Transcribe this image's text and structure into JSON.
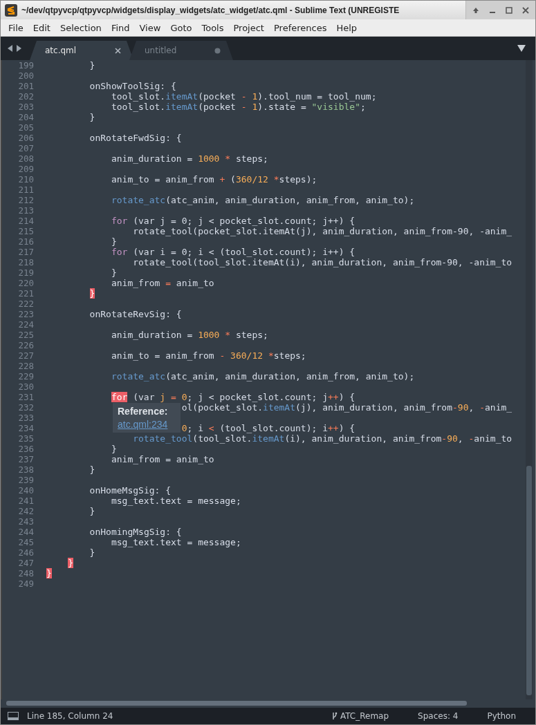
{
  "window": {
    "title": "~/dev/qtpyvcp/qtpyvcp/widgets/display_widgets/atc_widget/atc.qml - Sublime Text (UNREGISTE"
  },
  "menu": [
    "File",
    "Edit",
    "Selection",
    "Find",
    "View",
    "Goto",
    "Tools",
    "Project",
    "Preferences",
    "Help"
  ],
  "tabs": [
    {
      "label": "atc.qml",
      "selected": true,
      "modified": false
    },
    {
      "label": "untitled",
      "selected": false,
      "modified": true
    }
  ],
  "lines": [
    {
      "number": "199",
      "code": [
        {
          "kind": "plain",
          "text": "        }"
        }
      ]
    },
    {
      "number": "200"
    },
    {
      "number": "201",
      "code": [
        {
          "kind": "plain",
          "text": "        onShowToolSig: {"
        }
      ]
    },
    {
      "number": "202",
      "code": [
        {
          "kind": "plain",
          "text": "            tool_slot."
        },
        {
          "kind": "func",
          "text": "itemAt"
        },
        {
          "kind": "plain",
          "text": "(pocket "
        },
        {
          "kind": "op",
          "text": "-"
        },
        {
          "kind": "num",
          "text": " 1"
        },
        {
          "kind": "plain",
          "text": ").tool_num = tool_num;"
        }
      ]
    },
    {
      "number": "203",
      "code": [
        {
          "kind": "plain",
          "text": "            tool_slot."
        },
        {
          "kind": "func",
          "text": "itemAt"
        },
        {
          "kind": "plain",
          "text": "(pocket "
        },
        {
          "kind": "op",
          "text": "-"
        },
        {
          "kind": "num",
          "text": " 1"
        },
        {
          "kind": "plain",
          "text": ").state = "
        },
        {
          "kind": "str",
          "text": "\"visible\""
        },
        {
          "kind": "plain",
          "text": ";"
        }
      ]
    },
    {
      "number": "204",
      "code": [
        {
          "kind": "plain",
          "text": "        }"
        }
      ]
    },
    {
      "number": "205"
    },
    {
      "number": "206",
      "code": [
        {
          "kind": "plain",
          "text": "        onRotateFwdSig: {"
        }
      ]
    },
    {
      "number": "207"
    },
    {
      "number": "208",
      "code": [
        {
          "kind": "plain",
          "text": "            anim_duration = "
        },
        {
          "kind": "num",
          "text": "1000"
        },
        {
          "kind": "op",
          "text": " *"
        },
        {
          "kind": "plain",
          "text": " steps;"
        }
      ]
    },
    {
      "number": "209"
    },
    {
      "number": "210",
      "code": [
        {
          "kind": "plain",
          "text": "            anim_to = anim_from "
        },
        {
          "kind": "op",
          "text": "+"
        },
        {
          "kind": "plain",
          "text": " ("
        },
        {
          "kind": "num",
          "text": "360/12"
        },
        {
          "kind": "op",
          "text": " *"
        },
        {
          "kind": "plain",
          "text": "steps);"
        }
      ]
    },
    {
      "number": "211"
    },
    {
      "number": "212",
      "code": [
        {
          "kind": "func",
          "text": "            rotate_atc"
        },
        {
          "kind": "plain",
          "text": "(atc_anim, anim_duration, anim_from, anim_to);"
        }
      ]
    },
    {
      "number": "213"
    },
    {
      "number": "214",
      "code": [
        {
          "kind": "keyword",
          "text": "            for"
        },
        {
          "kind": "plain",
          "text": " (var j = 0; j < pocket_slot.count; j++) {"
        }
      ]
    },
    {
      "number": "215",
      "code": [
        {
          "kind": "plain",
          "text": "                rotate_tool(pocket_slot.itemAt(j), anim_duration, anim_from-90, -anim_"
        }
      ]
    },
    {
      "number": "216",
      "code": [
        {
          "kind": "plain",
          "text": "            }"
        }
      ]
    },
    {
      "number": "217",
      "code": [
        {
          "kind": "keyword",
          "text": "            for"
        },
        {
          "kind": "plain",
          "text": " (var i = 0; i < (tool_slot.count); i++) {"
        }
      ]
    },
    {
      "number": "218",
      "code": [
        {
          "kind": "plain",
          "text": "                rotate_tool(tool_slot.itemAt(i), anim_duration, anim_from-90, -anim_to"
        }
      ]
    },
    {
      "number": "219",
      "code": [
        {
          "kind": "plain",
          "text": "            }"
        }
      ]
    },
    {
      "number": "220",
      "code": [
        {
          "kind": "plain",
          "text": "            anim_from "
        },
        {
          "kind": "op",
          "text": "="
        },
        {
          "kind": "plain",
          "text": " anim_to"
        }
      ]
    },
    {
      "number": "221",
      "code": [
        {
          "kind": "match",
          "text": "        }"
        }
      ]
    },
    {
      "number": "222"
    },
    {
      "number": "223",
      "code": [
        {
          "kind": "plain",
          "text": "        onRotateRevSig: {"
        }
      ]
    },
    {
      "number": "224"
    },
    {
      "number": "225",
      "code": [
        {
          "kind": "plain",
          "text": "            anim_duration = "
        },
        {
          "kind": "num",
          "text": "1000"
        },
        {
          "kind": "op",
          "text": " *"
        },
        {
          "kind": "plain",
          "text": " steps;"
        }
      ]
    },
    {
      "number": "226"
    },
    {
      "number": "227",
      "code": [
        {
          "kind": "plain",
          "text": "            anim_to = anim_from "
        },
        {
          "kind": "op",
          "text": "-"
        },
        {
          "kind": "num",
          "text": " 360/12"
        },
        {
          "kind": "op",
          "text": " *"
        },
        {
          "kind": "plain",
          "text": "steps;"
        }
      ]
    },
    {
      "number": "228"
    },
    {
      "number": "229",
      "code": [
        {
          "kind": "func",
          "text": "            rotate_atc"
        },
        {
          "kind": "plain",
          "text": "(atc_anim, anim_duration, anim_from, anim_to);"
        }
      ]
    },
    {
      "number": "230"
    },
    {
      "number": "231",
      "code": [
        {
          "kind": "match",
          "text": "            for"
        },
        {
          "kind": "plain",
          "text": " (var "
        },
        {
          "kind": "num",
          "text": "j"
        },
        {
          "kind": "op",
          "text": " ="
        },
        {
          "kind": "num",
          "text": " 0"
        },
        {
          "kind": "plain",
          "text": "; j < pocket_slot.count; j"
        },
        {
          "kind": "op",
          "text": "++"
        },
        {
          "kind": "plain",
          "text": ") {"
        }
      ]
    },
    {
      "number": "232",
      "code": [
        {
          "kind": "plain",
          "text": "                         ol(pocket_slot."
        },
        {
          "kind": "func",
          "text": "itemAt"
        },
        {
          "kind": "plain",
          "text": "(j), anim_duration, anim_from"
        },
        {
          "kind": "op",
          "text": "-"
        },
        {
          "kind": "num",
          "text": "90"
        },
        {
          "kind": "plain",
          "text": ", "
        },
        {
          "kind": "op",
          "text": "-"
        },
        {
          "kind": "plain",
          "text": "anim_"
        }
      ]
    },
    {
      "number": "233"
    },
    {
      "number": "234",
      "code": [
        {
          "kind": "num",
          "text": "                         0"
        },
        {
          "kind": "plain",
          "text": "; i "
        },
        {
          "kind": "op",
          "text": "<"
        },
        {
          "kind": "plain",
          "text": " (tool_slot.count); i"
        },
        {
          "kind": "op",
          "text": "++"
        },
        {
          "kind": "plain",
          "text": ") {"
        }
      ]
    },
    {
      "number": "235",
      "code": [
        {
          "kind": "func",
          "text": "                rotate_tool"
        },
        {
          "kind": "plain",
          "text": "(tool_slot."
        },
        {
          "kind": "func",
          "text": "itemAt"
        },
        {
          "kind": "plain",
          "text": "(i), anim_duration, anim_from"
        },
        {
          "kind": "op",
          "text": "-"
        },
        {
          "kind": "num",
          "text": "90"
        },
        {
          "kind": "plain",
          "text": ", "
        },
        {
          "kind": "op",
          "text": "-"
        },
        {
          "kind": "plain",
          "text": "anim_to"
        }
      ]
    },
    {
      "number": "236",
      "code": [
        {
          "kind": "plain",
          "text": "            }"
        }
      ]
    },
    {
      "number": "237",
      "code": [
        {
          "kind": "plain",
          "text": "            anim_from = anim_to"
        }
      ]
    },
    {
      "number": "238",
      "code": [
        {
          "kind": "plain",
          "text": "        }"
        }
      ]
    },
    {
      "number": "239"
    },
    {
      "number": "240",
      "code": [
        {
          "kind": "plain",
          "text": "        onHomeMsgSig: {"
        }
      ]
    },
    {
      "number": "241",
      "code": [
        {
          "kind": "plain",
          "text": "            msg_text.text = message;"
        }
      ]
    },
    {
      "number": "242",
      "code": [
        {
          "kind": "plain",
          "text": "        }"
        }
      ]
    },
    {
      "number": "243"
    },
    {
      "number": "244",
      "code": [
        {
          "kind": "plain",
          "text": "        onHomingMsgSig: {"
        }
      ]
    },
    {
      "number": "245",
      "code": [
        {
          "kind": "plain",
          "text": "            msg_text.text = message;"
        }
      ]
    },
    {
      "number": "246",
      "code": [
        {
          "kind": "plain",
          "text": "        }"
        }
      ]
    },
    {
      "number": "247",
      "code": [
        {
          "kind": "match",
          "text": "    }"
        }
      ]
    },
    {
      "number": "248",
      "code": [
        {
          "kind": "match",
          "text": "}"
        }
      ]
    },
    {
      "number": "249"
    }
  ],
  "tooltip": {
    "title": "Reference:",
    "link": "atc.qml:234"
  },
  "status_bar": {
    "position": "Line 185, Column 24",
    "branch": "ATC_Remap",
    "indentation": "Spaces: 4",
    "syntax": "Python"
  }
}
